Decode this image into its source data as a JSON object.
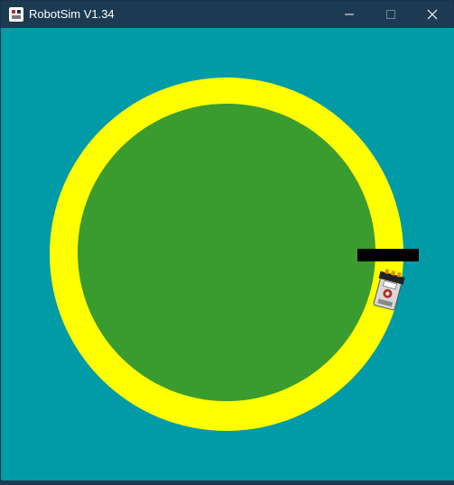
{
  "window": {
    "title": "RobotSim V1.34",
    "app_icon": "robot-app-icon",
    "controls": {
      "minimize_icon": "minimize-icon",
      "maximize_icon": "maximize-icon",
      "close_icon": "close-icon"
    }
  },
  "simulation": {
    "colors": {
      "background": "#009ba6",
      "track_outer": "#ffff00",
      "field_inner": "#3a9c2e",
      "sensor_bar": "#000000",
      "robot_body": "#d8d8d8"
    },
    "robot_icon": "robot-icon"
  }
}
